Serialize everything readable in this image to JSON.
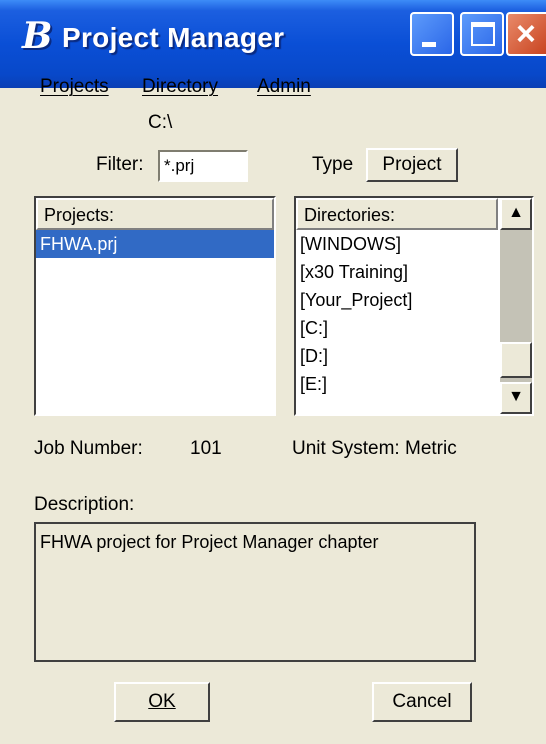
{
  "window": {
    "title": "Project Manager",
    "app_icon": "B",
    "controls": {
      "minimize": "minimize-icon",
      "maximize": "maximize-icon",
      "close": "close-icon"
    }
  },
  "menu": [
    {
      "label": "Projects"
    },
    {
      "label": "Directory"
    },
    {
      "label": "Admin"
    }
  ],
  "current_path": "C:\\",
  "filter": {
    "label": "Filter:",
    "value": "*.prj"
  },
  "type": {
    "label": "Type",
    "button": "Project"
  },
  "projects": {
    "header": "Projects:",
    "items": [
      "FHWA.prj"
    ],
    "selected_index": 0
  },
  "directories": {
    "header": "Directories:",
    "items": [
      "[WINDOWS]",
      "[x30 Training]",
      "[Your_Project]",
      "[C:]",
      "[D:]",
      "[E:]"
    ]
  },
  "job_number": {
    "label": "Job Number:",
    "value": "101"
  },
  "unit_system": {
    "label": "Unit System:",
    "value": "Metric"
  },
  "description": {
    "label": "Description:",
    "value": "FHWA project for Project Manager chapter"
  },
  "buttons": {
    "ok": "OK",
    "cancel": "Cancel"
  },
  "colors": {
    "titlebar": "#0a4fd6",
    "selection": "#316ac5",
    "dialog_bg": "#ece9d8"
  }
}
